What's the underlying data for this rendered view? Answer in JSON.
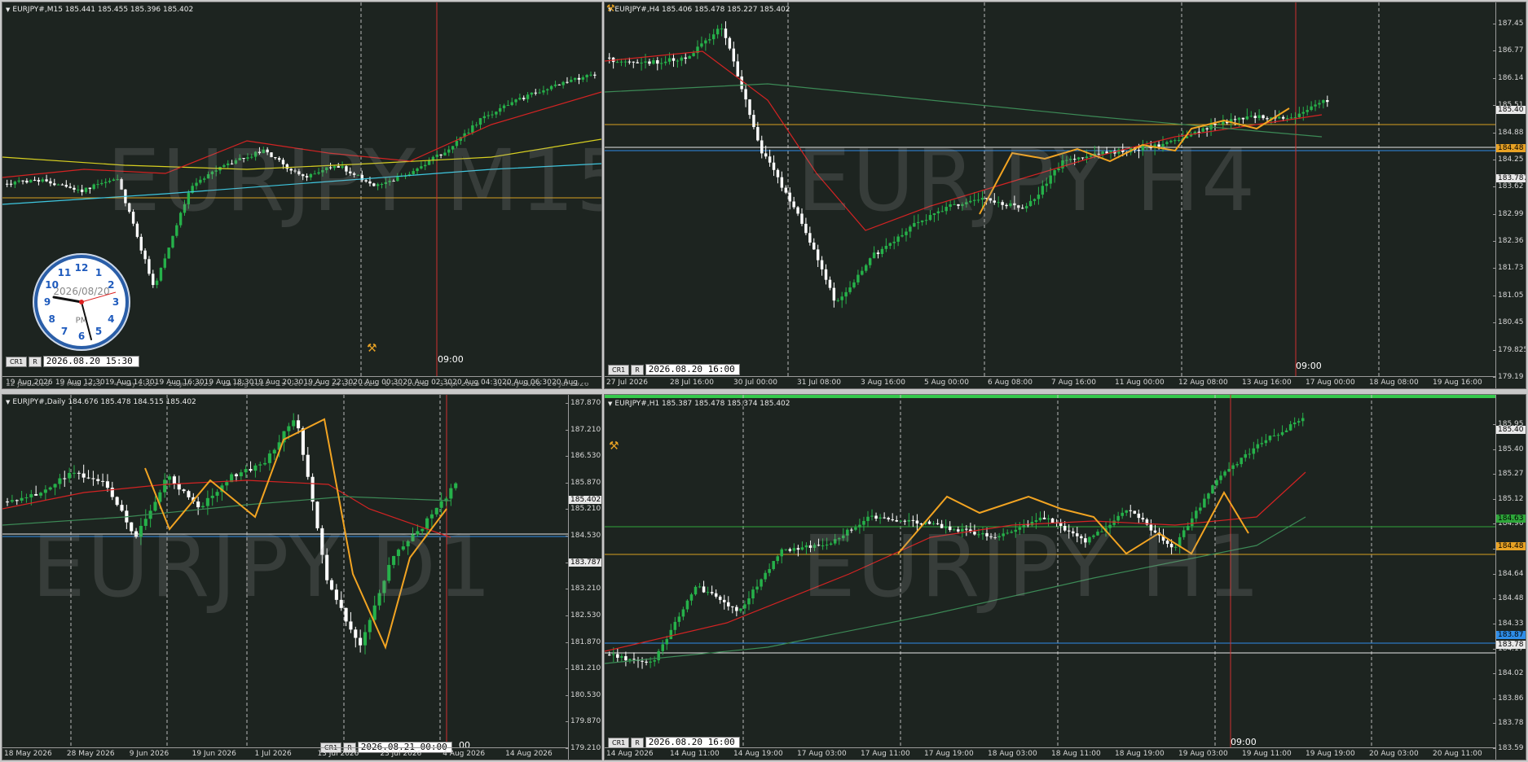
{
  "colors": {
    "chart_bg": "#1d2420",
    "bull_candle": "#26b14a",
    "bear_candle": "#ffffff",
    "ma_red": "#d42323",
    "ma_green": "#3c8a56",
    "ma_yellow": "#d8d020",
    "ma_cyan": "#3ec7e0",
    "zigzag": "#f2a422",
    "h_orange": "#d8a020",
    "h_blue": "#2e8de8",
    "h_white": "#e8e8e8",
    "h_green": "#2ea63a",
    "vline_red": "#d03030",
    "grid": "#c8c8c8"
  },
  "charts": {
    "m15": {
      "header": "EURJPY#,M15  185.441 185.455 185.396 185.402",
      "watermark": "EURJPY M15",
      "time_labels": [
        "19 Aug 2026",
        "19 Aug 12:30",
        "19 Aug 14:30",
        "19 Aug 16:30",
        "19 Aug 18:30",
        "19 Aug 20:30",
        "19 Aug 22:30",
        "20 Aug 00:30",
        "20 Aug 02:30",
        "20 Aug 04:30",
        "20 Aug 06:30",
        "20 Aug"
      ],
      "lower_time_labels": [
        "12 Jan 2023",
        "9 Mar 2023",
        "4 May 2023",
        "29 Jun 2023",
        "24 Aug 2023",
        "19 Oct 2023",
        "14 Dec 2023",
        "8 Feb 2026",
        "3 Apr 2026",
        "31 May 2026",
        "26 Jul 2026"
      ],
      "cr_label": "CR1",
      "r_label": "R",
      "time_value": "2026.08.20 15:30",
      "vline_label": "09:00",
      "clock": {
        "date": "2026/08/20",
        "ampm": "PM",
        "numbers": [
          "12",
          "1",
          "2",
          "3",
          "4",
          "5",
          "6",
          "7",
          "8",
          "9",
          "10",
          "11"
        ]
      }
    },
    "h4": {
      "header": "EURJPY#,H4  185.406 185.478 185.227 185.402",
      "watermark": "EURJPY H4",
      "price_ticks": [
        "187.45",
        "186.77",
        "186.14",
        "185.51",
        "184.88",
        "184.25",
        "183.62",
        "182.99",
        "182.36",
        "181.73",
        "181.05",
        "180.45",
        "179.825",
        "179.19"
      ],
      "tags": [
        {
          "label": "185.40",
          "kind": "white"
        },
        {
          "label": "184.48",
          "kind": "orange"
        },
        {
          "label": "183.787",
          "kind": "white"
        }
      ],
      "time_labels": [
        "27 Jul 2026",
        "28 Jul 16:00",
        "30 Jul 00:00",
        "31 Jul 08:00",
        "3 Aug 16:00",
        "5 Aug 00:00",
        "6 Aug 08:00",
        "7 Aug 16:00",
        "11 Aug 00:00",
        "12 Aug 08:00",
        "13 Aug 16:00",
        "17 Aug 00:00",
        "18 Aug 08:00",
        "19 Aug 16:00"
      ],
      "cr_label": "CR1",
      "r_label": "R",
      "time_value": "2026.08.20 16:00",
      "vline_label": "09:00"
    },
    "d1": {
      "header": "EURJPY#,Daily  184.676 185.478 184.515 185.402",
      "watermark": "EURJPY D1",
      "price_ticks": [
        "187.870",
        "187.210",
        "186.530",
        "185.870",
        "185.210",
        "184.530",
        "183.870",
        "183.210",
        "182.530",
        "181.870",
        "181.210",
        "180.530",
        "179.870",
        "179.210"
      ],
      "tags": [
        {
          "label": "185.402",
          "kind": "white"
        },
        {
          "label": "183.787",
          "kind": "white"
        }
      ],
      "time_labels": [
        "18 May 2026",
        "28 May 2026",
        "9 Jun 2026",
        "19 Jun 2026",
        "1 Jul 2026",
        "13 Jul 2026",
        "23 Jul 2026",
        "4 Aug 2026",
        "14 Aug 2026"
      ],
      "cr_label": "CR1",
      "r_label": "R",
      "time_value": "2026.08.21 00:00",
      "vline_label": "00"
    },
    "h1": {
      "header": "EURJPY#,H1  185.387 185.478 185.374 185.402",
      "watermark": "EURJPY H1",
      "price_ticks": [
        "185.95",
        "185.40",
        "185.27",
        "185.12",
        "184.96",
        "184.80",
        "184.64",
        "184.48",
        "184.33",
        "184.17",
        "184.02",
        "183.86",
        "183.78",
        "183.59"
      ],
      "tags": [
        {
          "label": "185.40",
          "kind": "white"
        },
        {
          "label": "184.63",
          "kind": "green"
        },
        {
          "label": "184.48",
          "kind": "orange"
        },
        {
          "label": "183.87",
          "kind": "blue"
        },
        {
          "label": "183.78",
          "kind": "white"
        }
      ],
      "time_labels": [
        "14 Aug 2026",
        "14 Aug 11:00",
        "14 Aug 19:00",
        "17 Aug 03:00",
        "17 Aug 11:00",
        "17 Aug 19:00",
        "18 Aug 03:00",
        "18 Aug 11:00",
        "18 Aug 19:00",
        "19 Aug 03:00",
        "19 Aug 11:00",
        "19 Aug 19:00",
        "20 Aug 03:00",
        "20 Aug 11:00"
      ],
      "cr_label": "CR1",
      "r_label": "R",
      "time_value": "2026.08.20 16:00",
      "vline_label": "09:00"
    }
  }
}
